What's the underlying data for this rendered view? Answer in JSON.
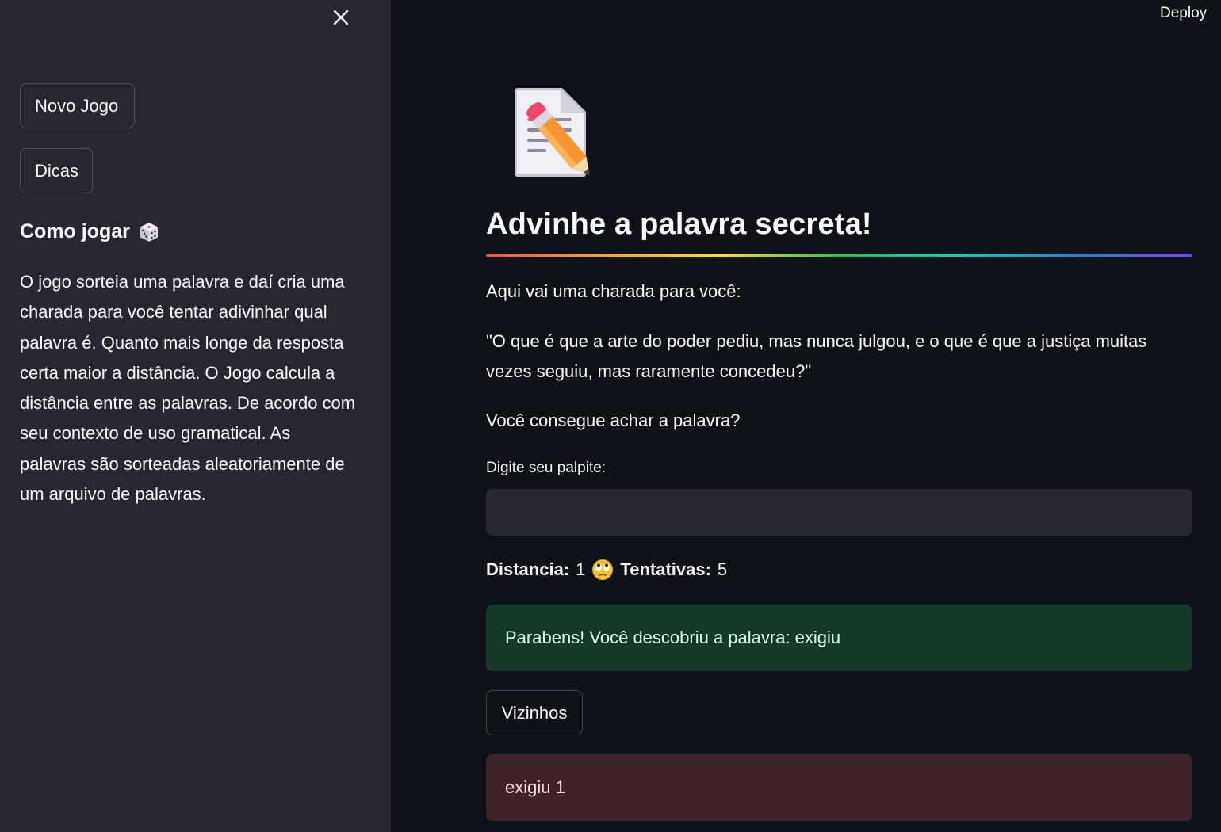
{
  "sidebar": {
    "close_icon": "close-icon",
    "buttons": {
      "new_game": "Novo Jogo",
      "hints": "Dicas"
    },
    "how_to_play": {
      "heading": "Como jogar",
      "icon": "dice-icon",
      "text": "O jogo sorteia uma palavra e daí cria uma charada para você tentar adivinhar qual palavra é. Quanto mais longe da resposta certa maior a distância. O Jogo calcula a distância entre as palavras. De acordo com seu contexto de uso gramatical. As palavras são sorteadas aleatoriamente de um arquivo de palavras."
    }
  },
  "header": {
    "deploy_label": "Deploy"
  },
  "main": {
    "icon": "memo-pencil-icon",
    "title": "Advinhe a palavra secreta!",
    "intro": "Aqui vai uma charada para você:",
    "riddle": "\"O que é que a arte do poder pediu, mas nunca julgou, e o que é que a justiça muitas vezes seguiu, mas raramente concedeu?\"",
    "question": "Você consegue achar a palavra?",
    "input": {
      "label": "Digite seu palpite:",
      "value": "",
      "placeholder": ""
    },
    "stats": {
      "distance_label": "Distancia:",
      "distance_value": "1",
      "emoji": "face-with-rolling-eyes-icon",
      "attempts_label": "Tentativas:",
      "attempts_value": "5"
    },
    "success_message": "Parabens! Você descobriu a palavra: exigiu",
    "neighbors_button": "Vizinhos",
    "neighbor_result": "exigiu 1"
  },
  "colors": {
    "app_bg": "#0e1117",
    "sidebar_bg": "#262730",
    "success_bg": "#173928",
    "error_bg": "#3e2428"
  }
}
